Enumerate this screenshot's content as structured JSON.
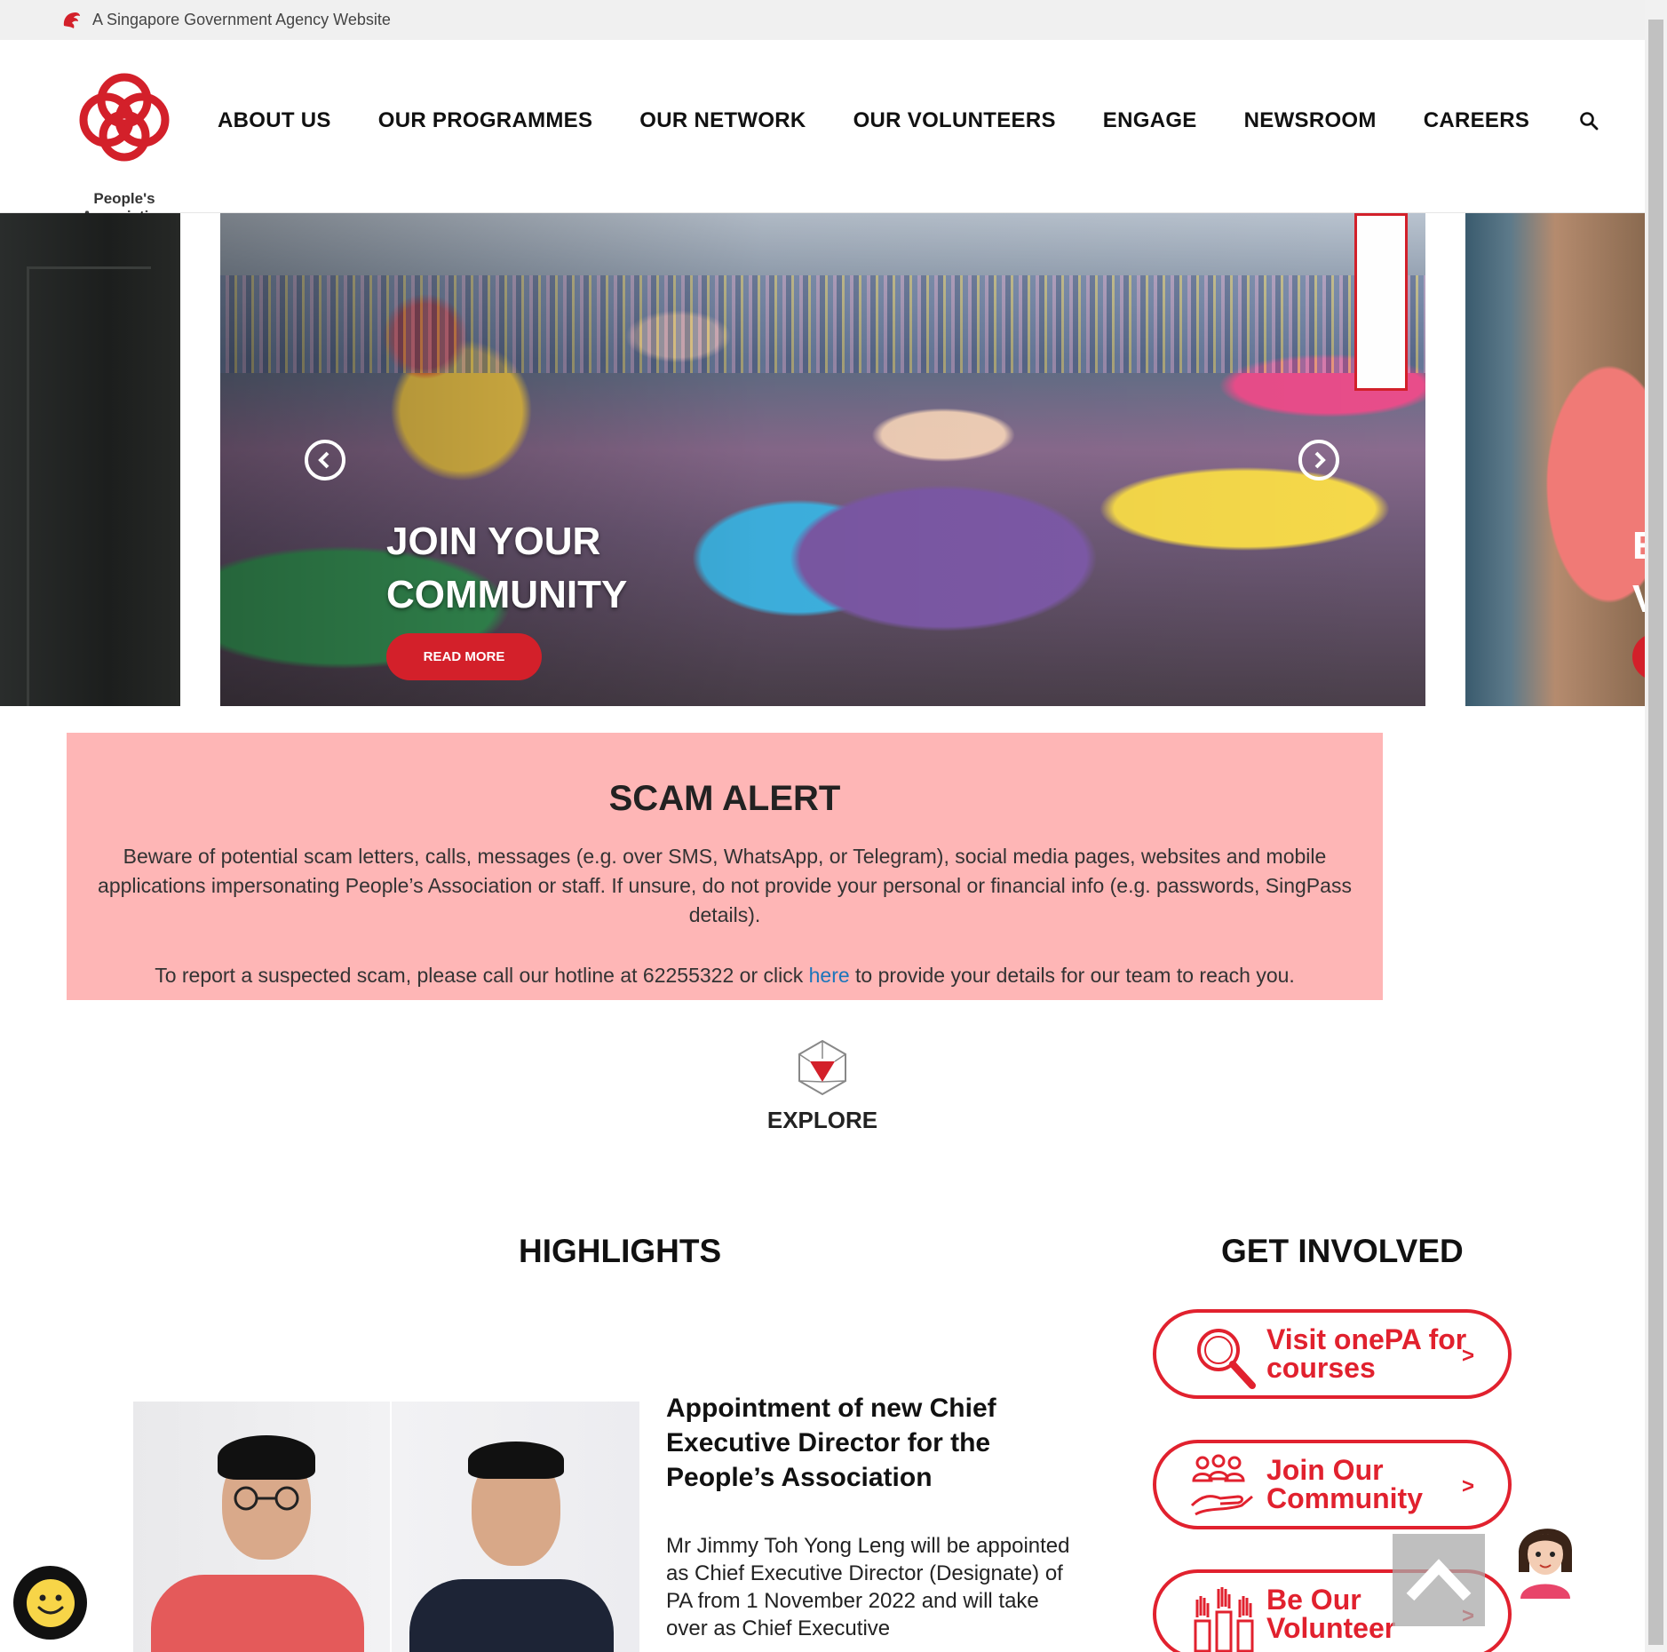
{
  "masthead": {
    "text": "A Singapore Government Agency Website",
    "icon": "lion-head-icon"
  },
  "header": {
    "logo_text": "People's Association",
    "nav": [
      "ABOUT US",
      "OUR PROGRAMMES",
      "OUR NETWORK",
      "OUR VOLUNTEERS",
      "ENGAGE",
      "NEWSROOM",
      "CAREERS"
    ],
    "search_icon": "search-icon"
  },
  "carousel": {
    "slide_title_line1": "JOIN YOUR",
    "slide_title_line2": "COMMUNITY",
    "read_more": "READ MORE",
    "peek_title_line1": "E",
    "peek_title_line2": "V",
    "prev_icon": "chevron-left-circle-icon",
    "next_icon": "chevron-right-circle-icon"
  },
  "scam_alert": {
    "title": "SCAM ALERT",
    "paragraph1": "Beware of potential scam letters, calls, messages (e.g. over SMS, WhatsApp, or Telegram), social media pages, websites and mobile applications impersonating People’s Association or staff. If unsure, do not provide your personal or financial info (e.g. passwords, SingPass details).",
    "p2_before": "To report a suspected scam, please call our hotline at 62255322 or click ",
    "p2_link": "here",
    "p2_after": " to provide your details for our team to reach you."
  },
  "explore": {
    "label": "EXPLORE"
  },
  "highlights": {
    "title": "HIGHLIGHTS",
    "article_heading": "Appointment of new Chief Executive Director for the People’s Association",
    "article_text": "Mr Jimmy Toh Yong Leng will be appointed as Chief Executive Director (Designate) of PA from 1 November 2022 and will take over as Chief Executive"
  },
  "get_involved": {
    "title": "GET INVOLVED",
    "buttons": [
      {
        "label": "Visit onePA for courses",
        "icon": "magnifier-icon",
        "chevron": ">"
      },
      {
        "label": "Join Our Community",
        "icon": "community-hands-icon",
        "chevron": ">"
      },
      {
        "label": "Be Our Volunteer",
        "icon": "raised-hands-icon",
        "chevron": ">"
      }
    ]
  },
  "colors": {
    "brand_red": "#e1212e",
    "alert_bg": "#feb6b6",
    "link": "#1a75bb"
  }
}
